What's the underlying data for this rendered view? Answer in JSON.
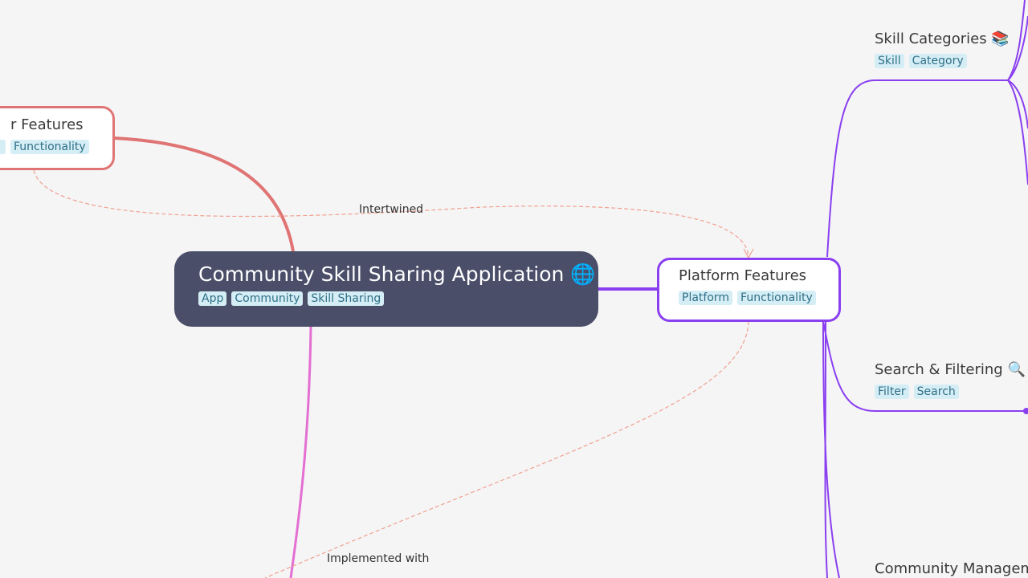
{
  "root": {
    "title": "Community Skill Sharing Application 🌐",
    "tags": [
      "App",
      "Community",
      "Skill Sharing"
    ]
  },
  "user_features": {
    "title": "r Features",
    "tags": [
      "",
      "Functionality"
    ]
  },
  "platform_features": {
    "title": "Platform Features",
    "tags": [
      "Platform",
      "Functionality"
    ]
  },
  "skill_categories": {
    "title": "Skill Categories 📚",
    "tags": [
      "Skill",
      "Category"
    ]
  },
  "search_filtering": {
    "title": "Search & Filtering 🔍",
    "tags": [
      "Filter",
      "Search"
    ]
  },
  "community_management": {
    "title": "Community Manageme"
  },
  "edge_labels": {
    "intertwined": "Intertwined",
    "implemented_with": "Implemented with"
  },
  "colors": {
    "root": "#4a4e69",
    "platform": "#8a3ff0",
    "user": "#e07474",
    "pink_branch": "#e46fd2",
    "dashed": "#f0a090",
    "tag_bg": "#d5eef6"
  }
}
